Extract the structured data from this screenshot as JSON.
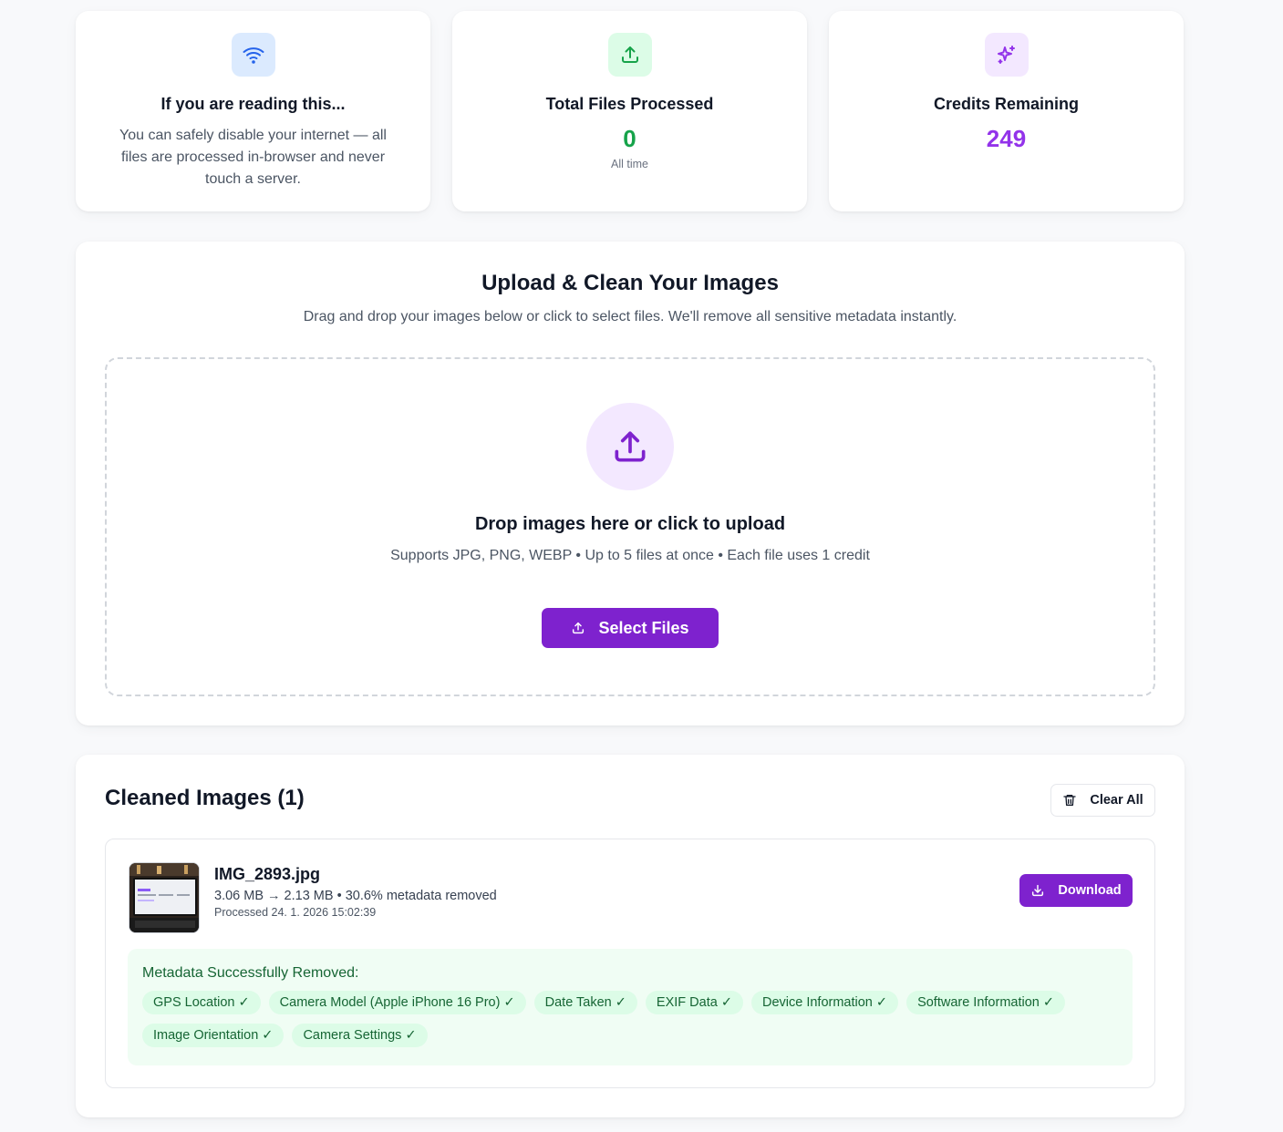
{
  "stats": [
    {
      "icon": "wifi-icon",
      "title": "If you are reading this...",
      "description": "You can safely disable your internet — all files are processed in-browser and never touch a server.",
      "color": "#2563eb",
      "bg": "#dbeafe"
    },
    {
      "icon": "upload-icon",
      "title": "Total Files Processed",
      "value": "0",
      "sub": "All time",
      "color": "#16a34a",
      "bg": "#dcfce7"
    },
    {
      "icon": "sparkles-icon",
      "title": "Credits Remaining",
      "value": "249",
      "color": "#9333ea",
      "bg": "#f3e8ff"
    }
  ],
  "upload": {
    "title": "Upload & Clean Your Images",
    "lead": "Drag and drop your images below or click to select files. We'll remove all sensitive metadata instantly.",
    "drop_title": "Drop images here or click to upload",
    "drop_sub": "Supports JPG, PNG, WEBP • Up to 5 files at once • Each file uses 1 credit",
    "button_label": "Select Files"
  },
  "cleaned": {
    "title": "Cleaned Images (1)",
    "clear_label": "Clear All",
    "file": {
      "name": "IMG_2893.jpg",
      "meta": "3.06 MB → 2.13 MB • 30.6% metadata removed",
      "processed": "Processed 24. 1. 2026 15:02:39",
      "download_label": "Download"
    },
    "removed_title": "Metadata Successfully Removed:",
    "removed": [
      "GPS Location ✓",
      "Camera Model (Apple iPhone 16 Pro) ✓",
      "Date Taken ✓",
      "EXIF Data ✓",
      "Device Information ✓",
      "Software Information ✓",
      "Image Orientation ✓",
      "Camera Settings ✓"
    ]
  },
  "colors": {
    "accent": "#7e22ce",
    "success_bg": "#f0fdf4",
    "success_text": "#166534"
  }
}
